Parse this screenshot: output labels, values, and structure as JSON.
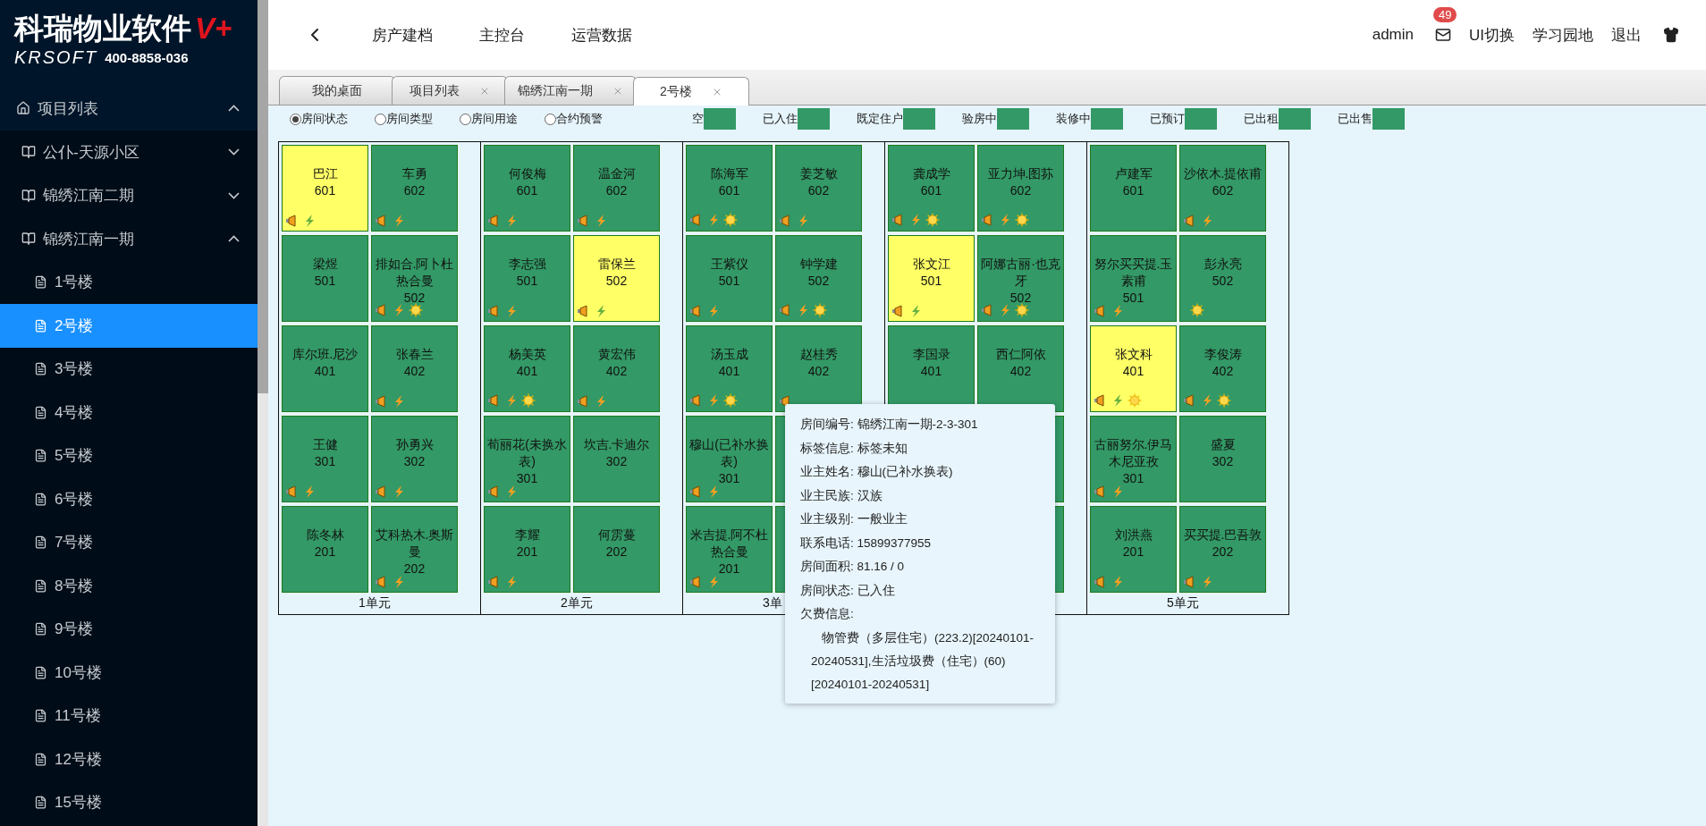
{
  "logo": {
    "title": "科瑞物业软件",
    "badge": "V+",
    "brand": "KRSOFT",
    "phone": "400-8858-036"
  },
  "sidebar": {
    "header": {
      "label": "项目列表",
      "expanded": true
    },
    "items": [
      {
        "label": "公仆-天源小区",
        "expanded": false
      },
      {
        "label": "锦绣江南二期",
        "expanded": false
      },
      {
        "label": "锦绣江南一期",
        "expanded": true,
        "children": [
          {
            "label": "1号楼",
            "selected": false
          },
          {
            "label": "2号楼",
            "selected": true
          },
          {
            "label": "3号楼",
            "selected": false
          },
          {
            "label": "4号楼",
            "selected": false
          },
          {
            "label": "5号楼",
            "selected": false
          },
          {
            "label": "6号楼",
            "selected": false
          },
          {
            "label": "7号楼",
            "selected": false
          },
          {
            "label": "8号楼",
            "selected": false
          },
          {
            "label": "9号楼",
            "selected": false
          },
          {
            "label": "10号楼",
            "selected": false
          },
          {
            "label": "11号楼",
            "selected": false
          },
          {
            "label": "12号楼",
            "selected": false
          },
          {
            "label": "15号楼",
            "selected": false
          }
        ]
      }
    ]
  },
  "topnav": {
    "links": [
      "房产建档",
      "主控台",
      "运营数据"
    ],
    "user": "admin",
    "mail_count": "49",
    "actions": [
      "UI切换",
      "学习园地",
      "退出"
    ]
  },
  "tabs": [
    {
      "label": "我的桌面",
      "closable": false,
      "selected": false
    },
    {
      "label": "项目列表",
      "closable": true,
      "selected": false
    },
    {
      "label": "锦绣江南一期",
      "closable": true,
      "selected": false
    },
    {
      "label": "2号楼",
      "closable": true,
      "selected": true
    }
  ],
  "view_options": [
    {
      "label": "房间状态",
      "selected": true
    },
    {
      "label": "房间类型",
      "selected": false
    },
    {
      "label": "房间用途",
      "selected": false
    },
    {
      "label": "合约预警",
      "selected": false
    }
  ],
  "legend": [
    {
      "label": "空",
      "color": "#339966"
    },
    {
      "label": "已入住",
      "color": "#339966"
    },
    {
      "label": "既定住户",
      "color": "#339966"
    },
    {
      "label": "验房中",
      "color": "#339966"
    },
    {
      "label": "装修中",
      "color": "#339966"
    },
    {
      "label": "已预订",
      "color": "#339966"
    },
    {
      "label": "已出租",
      "color": "#339966"
    },
    {
      "label": "已出售",
      "color": "#339966"
    }
  ],
  "units": [
    {
      "label": "1单元",
      "rooms": [
        {
          "kind": "room",
          "name": "巴江",
          "number": "601",
          "color": "#ffff66",
          "water": true,
          "leaf": true
        },
        {
          "kind": "room",
          "name": "车勇",
          "number": "602",
          "color": "#339966",
          "water": true,
          "power": true
        },
        {
          "kind": "room",
          "name": "梁煜",
          "number": "501",
          "color": "#339966"
        },
        {
          "kind": "room",
          "name": "排如合.阿卜杜热合曼",
          "number": "502",
          "color": "#339966",
          "water": true,
          "power": true,
          "sun": true
        },
        {
          "kind": "room",
          "name": "库尔班.尼沙",
          "number": "401",
          "color": "#339966"
        },
        {
          "kind": "room",
          "name": "张春兰",
          "number": "402",
          "color": "#339966",
          "water": true,
          "power": true
        },
        {
          "kind": "room",
          "name": "王健",
          "number": "301",
          "color": "#339966",
          "water": true,
          "power": true
        },
        {
          "kind": "room",
          "name": "孙勇兴",
          "number": "302",
          "color": "#339966",
          "water": true,
          "power": true
        },
        {
          "kind": "room",
          "name": "陈冬林",
          "number": "201",
          "color": "#339966"
        },
        {
          "kind": "room",
          "name": "艾科热木.奥斯曼",
          "number": "202",
          "color": "#339966",
          "water": true,
          "power": true
        }
      ]
    },
    {
      "label": "2单元",
      "rooms": [
        {
          "kind": "room",
          "name": "何俊梅",
          "number": "601",
          "color": "#339966",
          "water": true,
          "power": true
        },
        {
          "kind": "room",
          "name": "温金河",
          "number": "602",
          "color": "#339966",
          "water": true,
          "power": true
        },
        {
          "kind": "room",
          "name": "李志强",
          "number": "501",
          "color": "#339966",
          "water": true,
          "power": true
        },
        {
          "kind": "room",
          "name": "雷保兰",
          "number": "502",
          "color": "#ffff66",
          "water": true,
          "leaf": true
        },
        {
          "kind": "room",
          "name": "杨美英",
          "number": "401",
          "color": "#339966",
          "water": true,
          "power": true,
          "sun": true
        },
        {
          "kind": "room",
          "name": "黄宏伟",
          "number": "402",
          "color": "#339966",
          "water": true,
          "power": true
        },
        {
          "kind": "room",
          "name": "荀丽花(未换水表)",
          "number": "301",
          "color": "#339966",
          "water": true,
          "power": true
        },
        {
          "kind": "room",
          "name": "坎吉.卡迪尔",
          "number": "302",
          "color": "#339966"
        },
        {
          "kind": "room",
          "name": "李耀",
          "number": "201",
          "color": "#339966",
          "water": true,
          "power": true
        },
        {
          "kind": "room",
          "name": "何雳蔓",
          "number": "202",
          "color": "#339966"
        }
      ]
    },
    {
      "label": "3单",
      "rooms": [
        {
          "kind": "room",
          "name": "陈海军",
          "number": "601",
          "color": "#339966",
          "water": true,
          "power": true,
          "sun": true
        },
        {
          "kind": "room",
          "name": "姜芝敏",
          "number": "602",
          "color": "#339966",
          "water": true,
          "power": true
        },
        {
          "kind": "room",
          "name": "王紫仪",
          "number": "501",
          "color": "#339966",
          "water": true,
          "power": true
        },
        {
          "kind": "room",
          "name": "钟学建",
          "number": "502",
          "color": "#339966",
          "water": true,
          "power": true,
          "sun": true
        },
        {
          "kind": "room",
          "name": "汤玉成",
          "number": "401",
          "color": "#339966",
          "water": true,
          "power": true,
          "sun": true
        },
        {
          "kind": "room",
          "name": "赵桂秀",
          "number": "402",
          "color": "#339966",
          "water": true
        },
        {
          "kind": "room",
          "name": "穆山(已补水换表)",
          "number": "301",
          "color": "#339966",
          "water": true,
          "power": true
        },
        {
          "kind": "covered"
        },
        {
          "kind": "room",
          "name": "米吉提.阿不杜热合曼",
          "number": "201",
          "color": "#339966",
          "water": true,
          "power": true
        },
        {
          "kind": "covered"
        }
      ]
    },
    {
      "rooms": [
        {
          "kind": "room",
          "name": "龚成学",
          "number": "601",
          "color": "#339966",
          "water": true,
          "power": true,
          "sun": true
        },
        {
          "kind": "room",
          "name": "亚力坤.图荪",
          "number": "602",
          "color": "#339966",
          "water": true,
          "power": true,
          "sun": true
        },
        {
          "kind": "room",
          "name": "张文江",
          "number": "501",
          "color": "#ffff66",
          "water": true,
          "leaf": true
        },
        {
          "kind": "room",
          "name": "阿娜古丽·也克牙",
          "number": "502",
          "color": "#339966",
          "water": true,
          "power": true,
          "sun": true
        },
        {
          "kind": "room",
          "name": "李国录",
          "number": "401",
          "color": "#339966"
        },
        {
          "kind": "room",
          "name": "西仁阿依",
          "number": "402",
          "color": "#339966"
        },
        {
          "kind": "covered"
        },
        {
          "kind": "covered"
        }
      ]
    },
    {
      "label": "5单元",
      "rooms": [
        {
          "kind": "room",
          "name": "卢建军",
          "number": "601",
          "color": "#339966"
        },
        {
          "kind": "room",
          "name": "沙依木.提依甫",
          "number": "602",
          "color": "#339966",
          "water": true,
          "power": true
        },
        {
          "kind": "room",
          "name": "努尔买买提.玉素甫",
          "number": "501",
          "color": "#339966",
          "water": true,
          "power": true
        },
        {
          "kind": "room",
          "name": "彭永亮",
          "number": "502",
          "color": "#339966",
          "sun": true
        },
        {
          "kind": "room",
          "name": "张文科",
          "number": "401",
          "color": "#ffff66",
          "water": true,
          "leaf": true,
          "sun": true
        },
        {
          "kind": "room",
          "name": "李俊涛",
          "number": "402",
          "color": "#339966",
          "water": true,
          "power": true,
          "sun": true
        },
        {
          "kind": "room",
          "name": "古丽努尔.伊马木尼亚孜",
          "number": "301",
          "color": "#339966",
          "water": true,
          "power": true
        },
        {
          "kind": "room",
          "name": "盛夏",
          "number": "302",
          "color": "#339966"
        },
        {
          "kind": "room",
          "name": "刘洪燕",
          "number": "201",
          "color": "#339966",
          "water": true,
          "power": true
        },
        {
          "kind": "room",
          "name": "买买提.巴吾敦",
          "number": "202",
          "color": "#339966",
          "water": true,
          "power": true
        }
      ]
    }
  ],
  "tooltip": {
    "lines": [
      {
        "label": "房间编号:",
        "value": "锦绣江南一期-2-3-301"
      },
      {
        "label": "标签信息:",
        "value": "标签未知"
      },
      {
        "label": "业主姓名:",
        "value": "穆山(已补水换表)"
      },
      {
        "label": "业主民族:",
        "value": "汉族"
      },
      {
        "label": "业主级别:",
        "value": "一般业主"
      },
      {
        "label": "联系电话:",
        "value": "15899377955"
      },
      {
        "label": "房间面积:",
        "value": "81.16 / 0"
      },
      {
        "label": "房间状态:",
        "value": "已入住"
      },
      {
        "label": "欠费信息:"
      }
    ],
    "arrears": "物管费（多层住宅）(223.2)[20240101-20240531],生活垃圾费（住宅）(60)[20240101-20240531]"
  }
}
